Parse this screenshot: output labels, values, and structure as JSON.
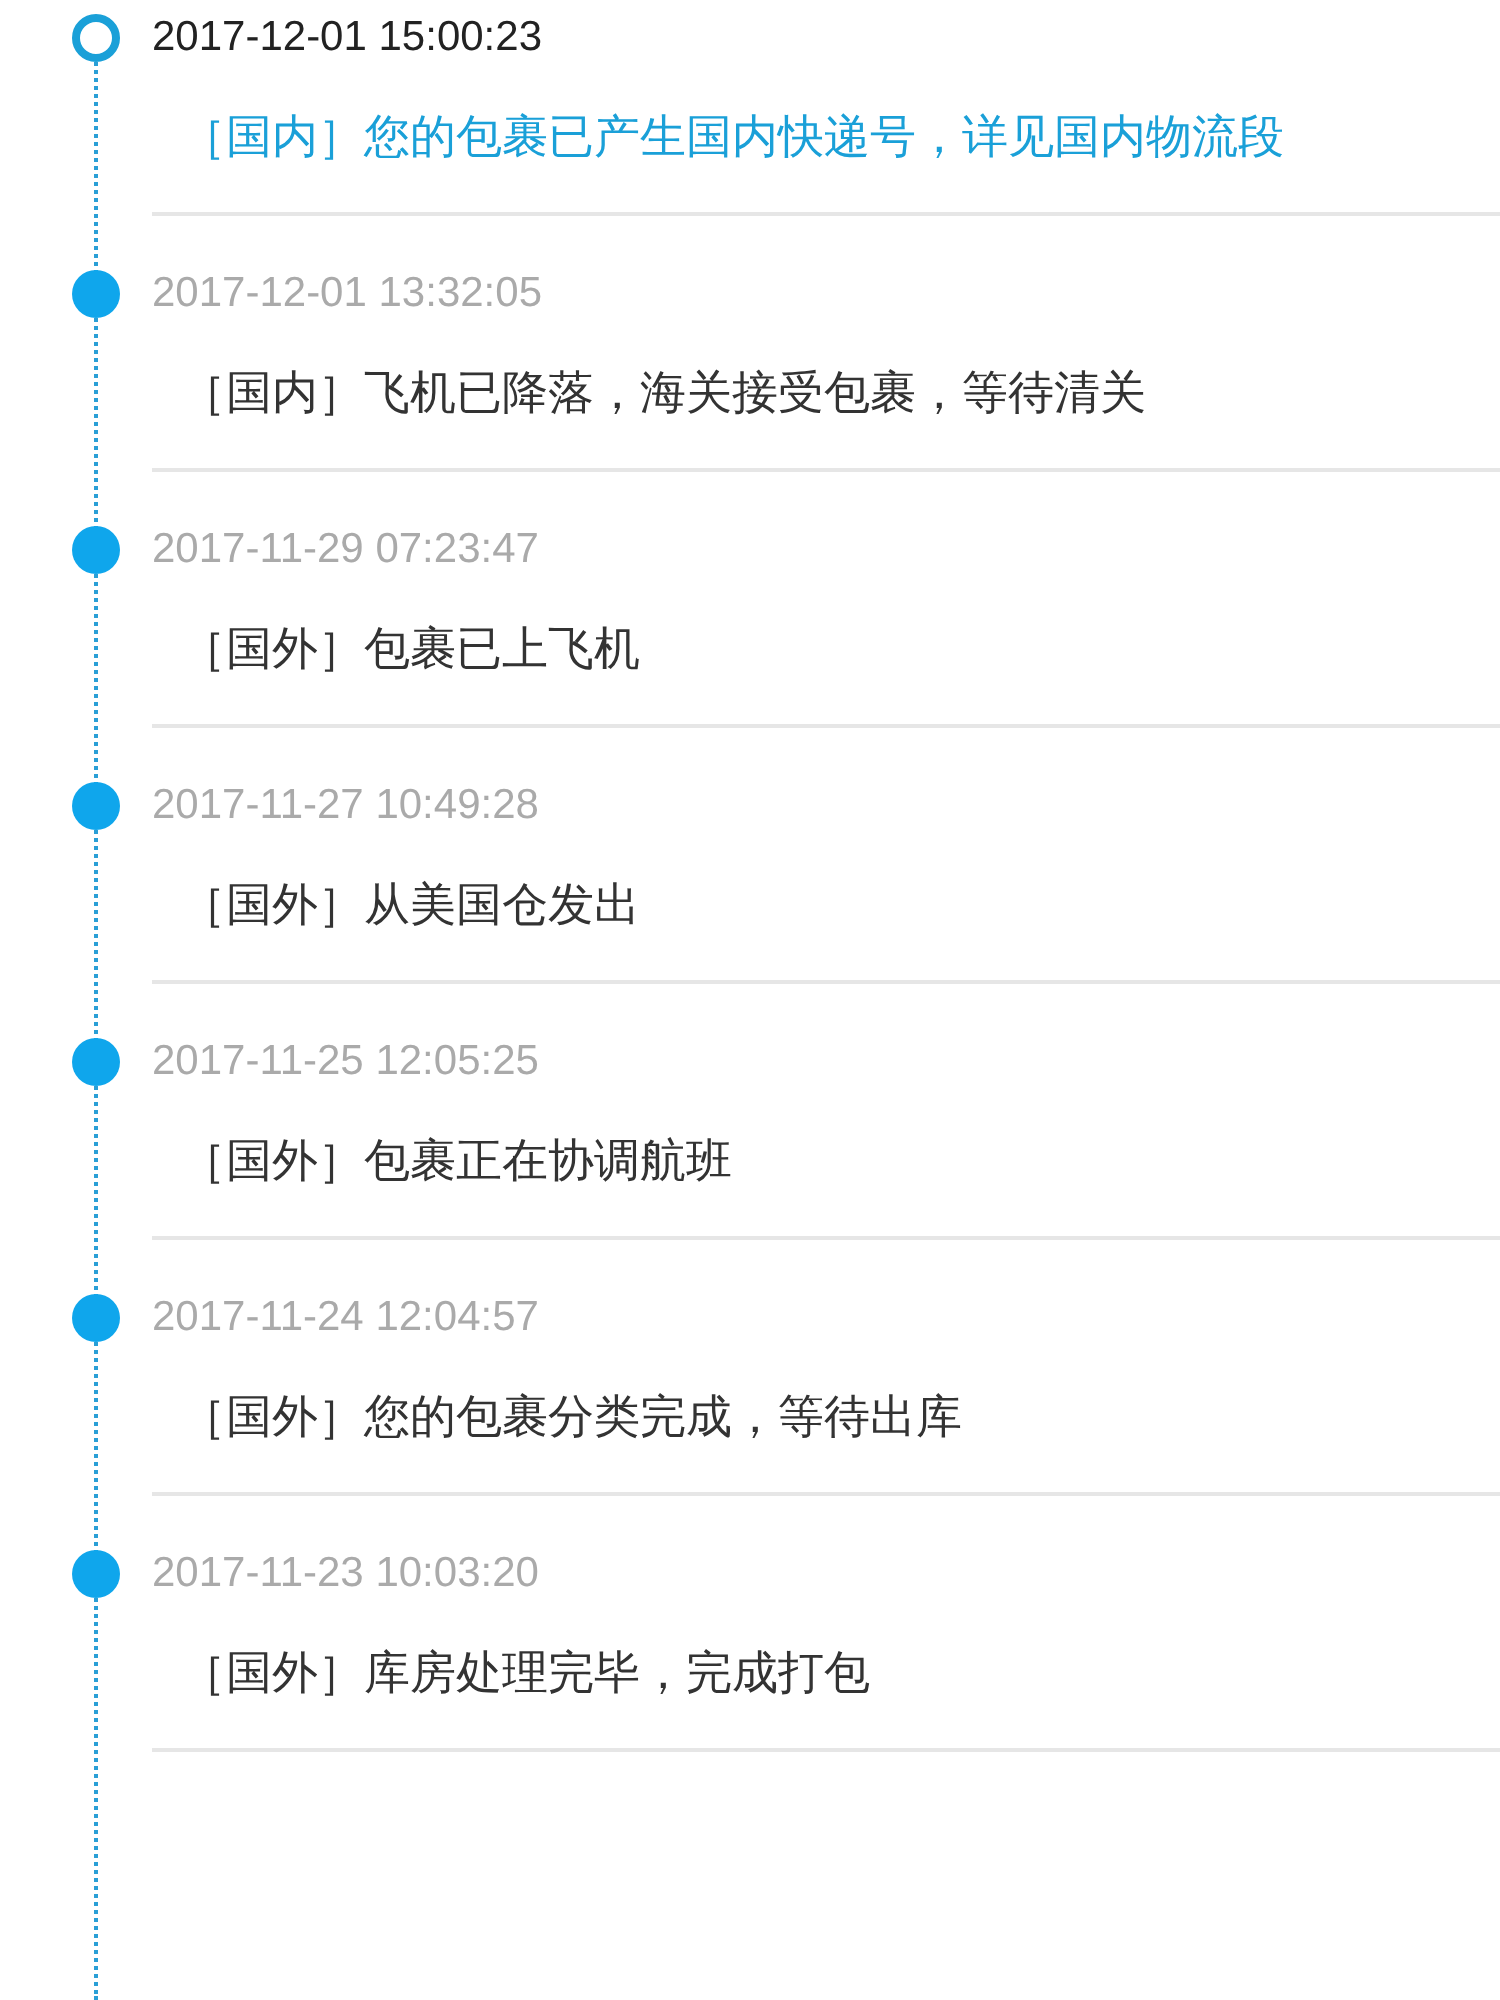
{
  "events": [
    {
      "time": "2017-12-01 15:00:23",
      "text": "［国内］您的包裹已产生国内快递号，详见国内物流段",
      "current": true
    },
    {
      "time": "2017-12-01 13:32:05",
      "text": "［国内］飞机已降落，海关接受包裹，等待清关",
      "current": false
    },
    {
      "time": "2017-11-29 07:23:47",
      "text": "［国外］包裹已上飞机",
      "current": false
    },
    {
      "time": "2017-11-27 10:49:28",
      "text": "［国外］从美国仓发出",
      "current": false
    },
    {
      "time": "2017-11-25 12:05:25",
      "text": "［国外］包裹正在协调航班",
      "current": false
    },
    {
      "time": "2017-11-24 12:04:57",
      "text": "［国外］您的包裹分类完成，等待出库",
      "current": false
    },
    {
      "time": "2017-11-23 10:03:20",
      "text": "［国外］库房处理完毕，完成打包",
      "current": false
    }
  ]
}
